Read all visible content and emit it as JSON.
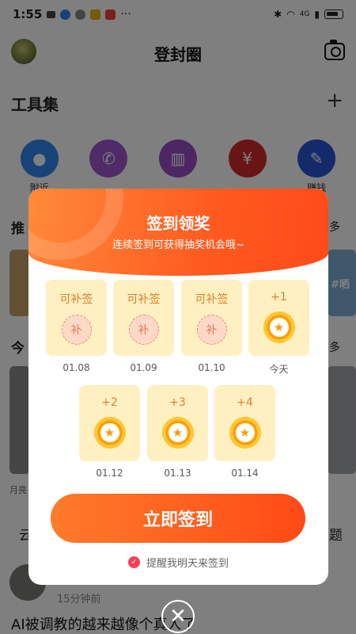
{
  "status_bar": {
    "time": "1:55",
    "extra": "···",
    "network": "4G"
  },
  "header": {
    "title": "登封圈"
  },
  "tools": {
    "heading": "工具集",
    "add_symbol": "+",
    "items": [
      {
        "icon": "location-pin-icon",
        "color": "#2f86f0",
        "label": "附近"
      },
      {
        "icon": "phone-icon",
        "color": "#9e58cf",
        "label": ""
      },
      {
        "icon": "chart-icon",
        "color": "#9a4ec7",
        "label": ""
      },
      {
        "icon": "red-envelope-icon",
        "color": "#d22a2a",
        "label": ""
      },
      {
        "icon": "edit-icon",
        "color": "#2a55d4",
        "label": "赚钱"
      }
    ]
  },
  "background_fragments": {
    "recommend_char": "推",
    "more_label_1": "多",
    "today_char": "今",
    "more_label_2": "多",
    "moon_char": "月亮",
    "yun_char": "云",
    "ti_char": "题",
    "photo_tag": "#晒"
  },
  "feed": {
    "time": "15分钟前",
    "title": "AI被调教的越来越像个真人了"
  },
  "modal": {
    "title": "签到领奖",
    "subtitle": "连续签到可获得抽奖机会哦~",
    "days": [
      {
        "label": "可补签",
        "badge": "补",
        "date": "01.08",
        "type": "makeup"
      },
      {
        "label": "可补签",
        "badge": "补",
        "date": "01.09",
        "type": "makeup"
      },
      {
        "label": "可补签",
        "badge": "补",
        "date": "01.10",
        "type": "makeup"
      },
      {
        "label": "+1",
        "badge": "★",
        "date": "今天",
        "type": "coin"
      },
      {
        "label": "+2",
        "badge": "★",
        "date": "01.12",
        "type": "coin"
      },
      {
        "label": "+3",
        "badge": "★",
        "date": "01.13",
        "type": "coin"
      },
      {
        "label": "+4",
        "badge": "★",
        "date": "01.14",
        "type": "coin"
      }
    ],
    "sign_button": "立即签到",
    "remind_text": "提醒我明天来签到",
    "close_symbol": "✕"
  },
  "colors": {
    "accent": "#ff5a20",
    "card_bg": "#fff0c2",
    "coin": "#ff9d00"
  }
}
